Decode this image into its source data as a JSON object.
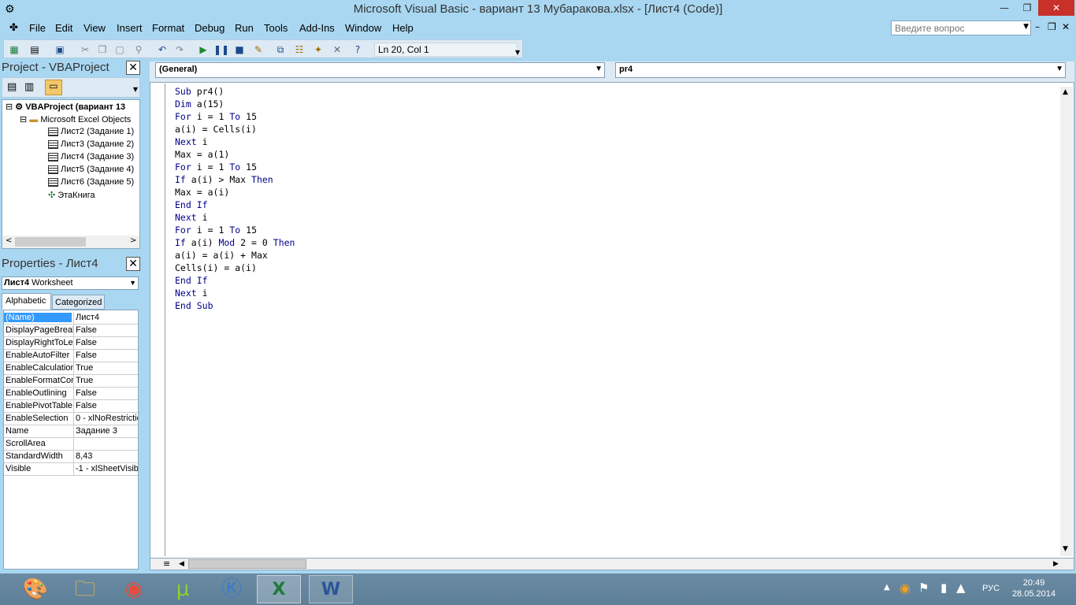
{
  "window": {
    "title": "Microsoft Visual Basic - вариант 13 Мубаракова.xlsx - [Лист4 (Code)]",
    "minimize_glyph": "—",
    "maximize_glyph": "❐",
    "close_glyph": "✕"
  },
  "menu": [
    "File",
    "Edit",
    "View",
    "Insert",
    "Format",
    "Debug",
    "Run",
    "Tools",
    "Add-Ins",
    "Window",
    "Help"
  ],
  "help_search": {
    "placeholder": "Введите вопрос"
  },
  "toolbar": {
    "cursor_position": "Ln 20, Col 1"
  },
  "project_panel": {
    "title": "Project - VBAProject",
    "root": "VBAProject (вариант 13",
    "folder": "Microsoft Excel Objects",
    "items": [
      "Лист2 (Задание 1)",
      "Лист3 (Задание 2)",
      "Лист4 (Задание 3)",
      "Лист5 (Задание 4)",
      "Лист6 (Задание 5)",
      "ЭтаКнига"
    ]
  },
  "properties_panel": {
    "title": "Properties - Лист4",
    "object_name": "Лист4",
    "object_type": "Worksheet",
    "tabs": [
      "Alphabetic",
      "Categorized"
    ],
    "rows": [
      {
        "name": "(Name)",
        "value": "Лист4"
      },
      {
        "name": "DisplayPageBreak",
        "value": "False"
      },
      {
        "name": "DisplayRightToLef",
        "value": "False"
      },
      {
        "name": "EnableAutoFilter",
        "value": "False"
      },
      {
        "name": "EnableCalculation",
        "value": "True"
      },
      {
        "name": "EnableFormatCon",
        "value": "True"
      },
      {
        "name": "EnableOutlining",
        "value": "False"
      },
      {
        "name": "EnablePivotTable",
        "value": "False"
      },
      {
        "name": "EnableSelection",
        "value": "0 - xlNoRestrictio"
      },
      {
        "name": "Name",
        "value": "Задание 3"
      },
      {
        "name": "ScrollArea",
        "value": ""
      },
      {
        "name": "StandardWidth",
        "value": "8,43"
      },
      {
        "name": "Visible",
        "value": "-1 - xlSheetVisib"
      }
    ]
  },
  "code_window": {
    "object_combo": "(General)",
    "procedure_combo": "pr4",
    "lines": [
      "Sub pr4()",
      "Dim a(15)",
      "For i = 1 To 15",
      "a(i) = Cells(i)",
      "Next i",
      "Max = a(1)",
      "For i = 1 To 15",
      "If a(i) > Max Then",
      "Max = a(i)",
      "End If",
      "Next i",
      "For i = 1 To 15",
      "If a(i) Mod 2 = 0 Then",
      "a(i) = a(i) + Max",
      "Cells(i) = a(i)",
      "End If",
      "Next i",
      "End Sub"
    ],
    "keyword_color": "#00008b",
    "text_color": "#000000"
  },
  "taskbar": {
    "apps": [
      "paint-icon",
      "explorer-icon",
      "chrome-icon",
      "utorrent-icon",
      "kmplayer-icon",
      "excel-icon",
      "word-icon"
    ],
    "language": "РУС",
    "time": "20:49",
    "date": "28.05.2014"
  }
}
